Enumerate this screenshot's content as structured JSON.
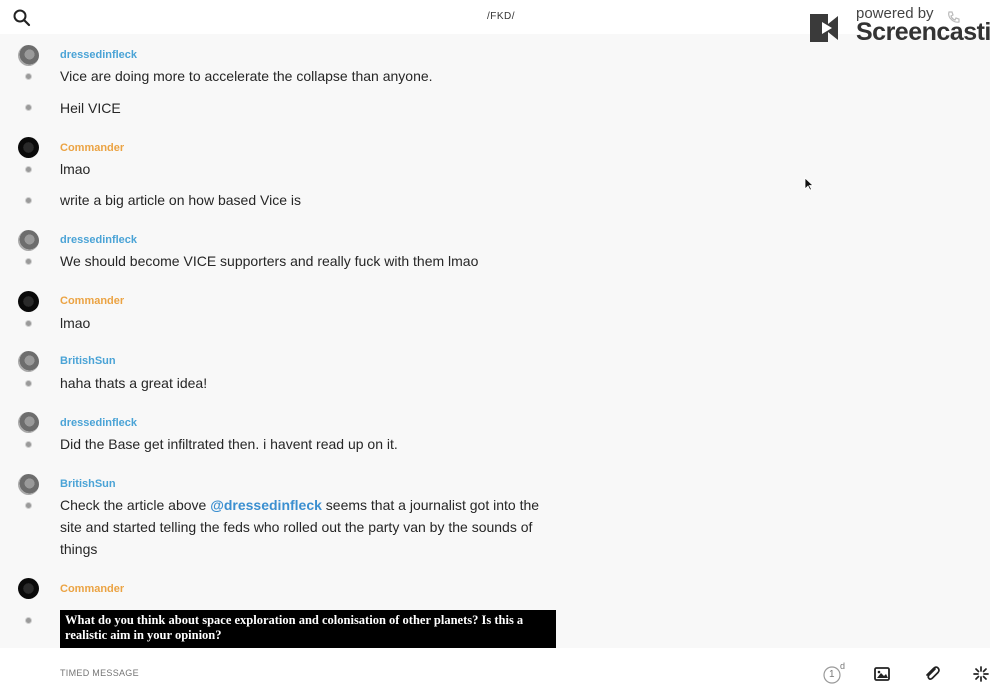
{
  "header": {
    "channel_title": "/FKD/",
    "watermark_line1": "powered by",
    "watermark_line2": "Screencastify"
  },
  "messages": [
    {
      "user": "dressedinfleck",
      "color": "#4aa3d6",
      "lines": [
        "Vice are doing more to accelerate the collapse than anyone.",
        "Heil VICE"
      ]
    },
    {
      "user": "Commander",
      "color": "#eba343",
      "lines": [
        "lmao",
        "write a big article on how based Vice is"
      ]
    },
    {
      "user": "dressedinfleck",
      "color": "#4aa3d6",
      "lines": [
        "We should become VICE supporters and really fuck with them lmao"
      ]
    },
    {
      "user": "Commander",
      "color": "#eba343",
      "lines": [
        "lmao"
      ]
    },
    {
      "user": "BritishSun",
      "color": "#4aa3d6",
      "lines": [
        "haha thats a great idea!"
      ]
    },
    {
      "user": "dressedinfleck",
      "color": "#4aa3d6",
      "lines": [
        "Did the Base get infiltrated then. i havent read up on it."
      ]
    },
    {
      "user": "BritishSun",
      "color": "#4aa3d6",
      "text_before": "Check the article above ",
      "mention": "@dressedinfleck",
      "text_after": " seems that a journalist got into the site and started telling the feds   who rolled out the party van by the sounds of things"
    },
    {
      "user": "Commander",
      "color": "#eba343",
      "image_text": "What do you think about space exploration and colonisation of other planets? Is this a realistic aim in your opinion?"
    }
  ],
  "composer": {
    "placeholder": "TIMED MESSAGE",
    "timer_value": "1",
    "timer_unit": "d"
  },
  "icons": {
    "search": "search-icon",
    "timer": "timer-icon",
    "image": "image-icon",
    "attach": "paperclip-icon",
    "sparkle": "sparkle-icon"
  }
}
